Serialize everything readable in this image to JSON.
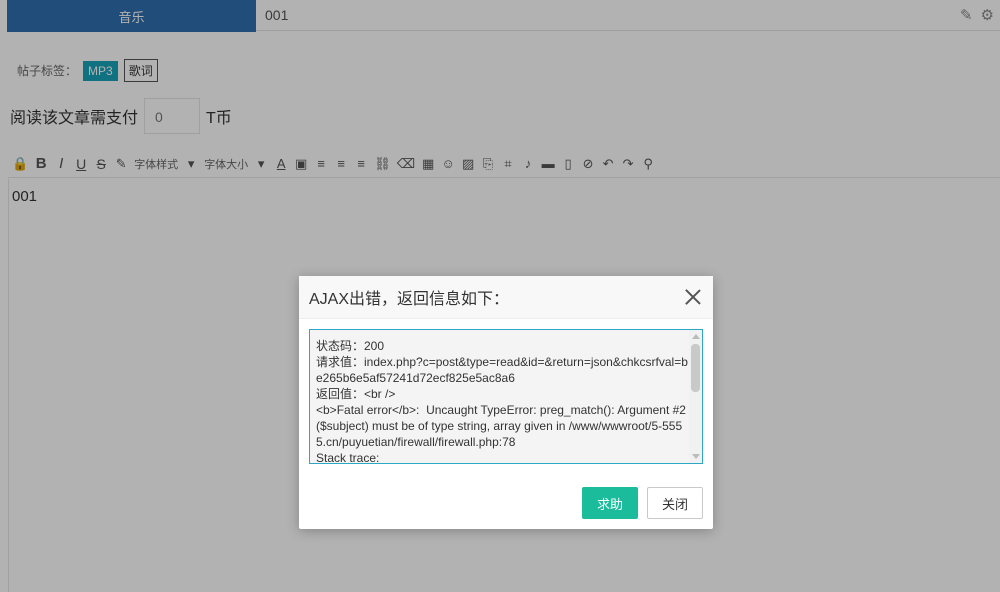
{
  "page": {
    "tab_active_label": "音乐",
    "title_value": "001",
    "tag_label": "帖子标签：",
    "tags": [
      "MP3",
      "歌词"
    ],
    "pay_label": "阅读该文章需支付",
    "pay_value": "0",
    "pay_unit": "T币",
    "toolbar": {
      "font_family_label": "字体样式",
      "font_size_label": "字体大小"
    },
    "editor_content": "001"
  },
  "dialog": {
    "title": "AJAX出错，返回信息如下：",
    "message_lines": [
      "状态码：200",
      "请求值：index.php?c=post&type=read&id=&return=json&chkcsrfval=be265b6e5af57241d72ecf825e5ac8a6",
      "返回值：<br />",
      "<b>Fatal error</b>:  Uncaught TypeError: preg_match(): Argument #2 ($subject) must be of type string, array given in /www/wwwroot/5-5555.cn/puyuetian/firewall/firewall.php:78",
      "Stack trace:"
    ],
    "help_button": "求助",
    "close_button": "关闭"
  },
  "colors": {
    "accent": "#1bbc9b",
    "tab_blue": "#2f6fae",
    "tag_teal": "#17a2b8",
    "message_border": "#2ea7c7"
  }
}
